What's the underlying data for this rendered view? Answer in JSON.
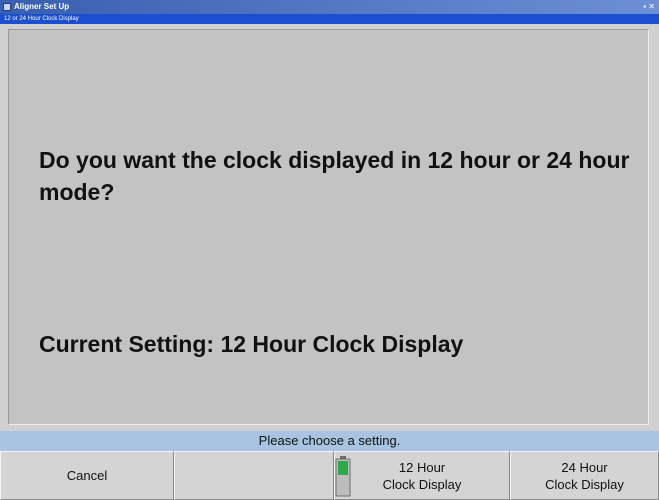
{
  "window": {
    "title": "Aligner Set Up",
    "subtitle": "12 or 24 Hour Clock Display"
  },
  "main": {
    "question": "Do you want the clock displayed in 12 hour or 24 hour mode?",
    "current_setting": "Current Setting: 12 Hour Clock Display"
  },
  "status": "Please choose a setting.",
  "buttons": {
    "b1": "Cancel",
    "b2": "",
    "b3": "12 Hour\nClock Display",
    "b4": "24 Hour\nClock Display"
  },
  "indicator": {
    "icon": "battery-level-icon",
    "color": "#2fa84a"
  },
  "colors": {
    "title_bar": "#3a5fb0",
    "sub_bar": "#1b4fd0",
    "panel": "#c3c3c3",
    "status_bar": "#a8c4e0"
  }
}
